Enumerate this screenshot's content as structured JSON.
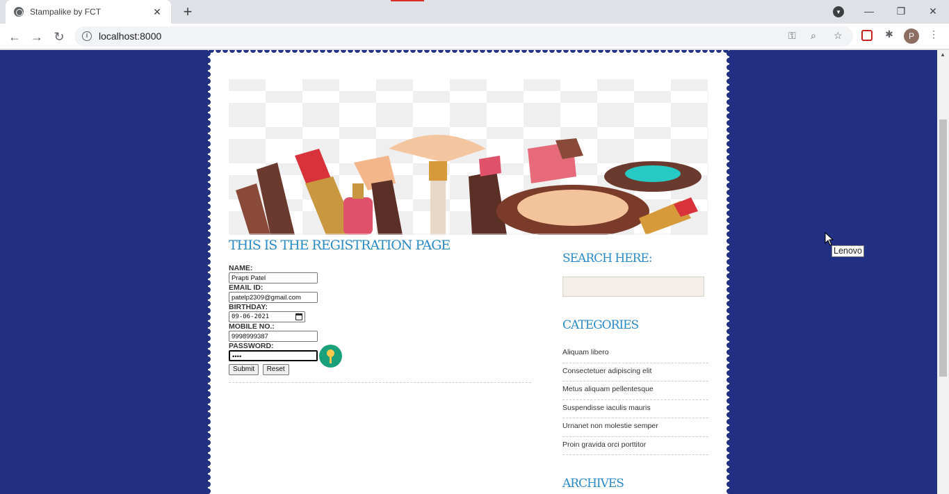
{
  "browser": {
    "tab_title": "Stampalike by FCT",
    "tab_close": "✕",
    "new_tab": "+",
    "url": "localhost:8000",
    "avatar_letter": "P",
    "minimize": "—",
    "restore": "❐",
    "close": "✕"
  },
  "page": {
    "title": "THIS IS THE REGISTRATION PAGE",
    "form": {
      "name_label": "NAME:",
      "name_value": "Prapti Patel",
      "email_label": "EMAIL ID:",
      "email_value": "patelp2309@gmail.com",
      "birthday_label": "BIRTHDAY:",
      "birthday_value": "09-06-2021",
      "mobile_label": "MOBILE NO.:",
      "mobile_value": "9998999387",
      "password_label": "PASSWORD:",
      "password_value": "••••",
      "submit_label": "Submit",
      "reset_label": "Reset"
    },
    "sidebar": {
      "search_heading": "SEARCH HERE:",
      "categories_heading": "CATEGORIES",
      "categories": [
        "Aliquam libero",
        "Consectetuer adipiscing elit",
        "Metus aliquam pellentesque",
        "Suspendisse iaculis mauris",
        "Urnanet non molestie semper",
        "Proin gravida orci porttitor"
      ],
      "archives_heading": "ARCHIVES"
    }
  },
  "tooltip": "Lenovo",
  "colors": {
    "page_background": "#223083",
    "heading": "#2a8ac8",
    "stamp": "#ffffff"
  }
}
